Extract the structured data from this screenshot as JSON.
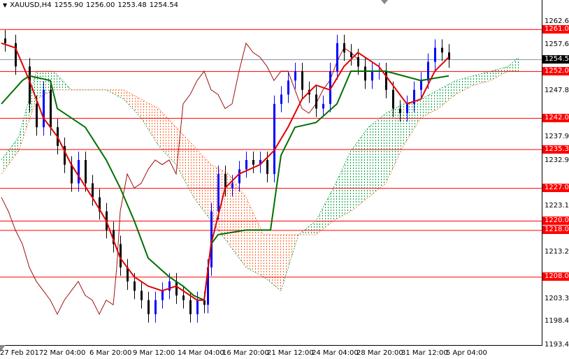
{
  "header": {
    "symbol": "XAUUSD,H4",
    "open": "1255.90",
    "high": "1256.00",
    "low": "1253.48",
    "close": "1254.54"
  },
  "colors": {
    "level": "#ff0000",
    "tenkan": "#e00000",
    "kijun": "#007000",
    "chikou": "#a01010",
    "cloud_bull": "#00a040",
    "cloud_bear": "#ff6020",
    "bull_candle": "#0000ff",
    "bear_candle": "#000000"
  },
  "y_axis": {
    "min": 1193.4,
    "max": 1262.6,
    "ticks": [
      "1262.60",
      "1257.60",
      "1247.80",
      "1237.90",
      "1232.90",
      "1223.10",
      "1213.20",
      "1203.30",
      "1198.40",
      "1193.40"
    ]
  },
  "levels": [
    "1261.00",
    "1252.00",
    "1242.00",
    "1235.30",
    "1227.00",
    "1220.00",
    "1218.00",
    "1208.00"
  ],
  "current_price": "1254.54",
  "x_axis": {
    "labels": [
      "27 Feb 2017",
      "2 Mar 04:00",
      "6 Mar 20:00",
      "9 Mar 12:00",
      "14 Mar 04:00",
      "16 Mar 20:00",
      "21 Mar 12:00",
      "24 Mar 04:00",
      "28 Mar 20:00",
      "31 Mar 12:00",
      "5 Apr 04:00"
    ]
  },
  "chart_data": {
    "type": "line",
    "title": "XAUUSD,H4",
    "x_unit": "bar index (H4)",
    "closes": [
      [
        1,
        1258
      ],
      [
        4,
        1253
      ],
      [
        8,
        1245
      ],
      [
        10,
        1240
      ],
      [
        12,
        1248
      ],
      [
        14,
        1240
      ],
      [
        16,
        1236
      ],
      [
        18,
        1232
      ],
      [
        20,
        1228
      ],
      [
        22,
        1233
      ],
      [
        24,
        1228
      ],
      [
        26,
        1225
      ],
      [
        28,
        1222
      ],
      [
        30,
        1218
      ],
      [
        32,
        1215
      ],
      [
        34,
        1210
      ],
      [
        36,
        1207
      ],
      [
        38,
        1205
      ],
      [
        40,
        1203
      ],
      [
        42,
        1200
      ],
      [
        44,
        1203
      ],
      [
        46,
        1205
      ],
      [
        48,
        1207
      ],
      [
        50,
        1204
      ],
      [
        52,
        1203
      ],
      [
        54,
        1200
      ],
      [
        56,
        1203
      ],
      [
        58,
        1202
      ],
      [
        59,
        1210
      ],
      [
        60,
        1222
      ],
      [
        62,
        1230
      ],
      [
        64,
        1227
      ],
      [
        66,
        1228
      ],
      [
        68,
        1231
      ],
      [
        70,
        1233
      ],
      [
        72,
        1232
      ],
      [
        74,
        1233
      ],
      [
        76,
        1230
      ],
      [
        78,
        1245
      ],
      [
        80,
        1247
      ],
      [
        82,
        1250
      ],
      [
        84,
        1252
      ],
      [
        86,
        1248
      ],
      [
        88,
        1247
      ],
      [
        90,
        1244
      ],
      [
        92,
        1245
      ],
      [
        94,
        1252
      ],
      [
        96,
        1258
      ],
      [
        98,
        1256
      ],
      [
        100,
        1255
      ],
      [
        102,
        1253
      ],
      [
        104,
        1250
      ],
      [
        106,
        1252
      ],
      [
        108,
        1252
      ],
      [
        110,
        1248
      ],
      [
        112,
        1244
      ],
      [
        114,
        1243
      ],
      [
        116,
        1245
      ],
      [
        118,
        1248
      ],
      [
        120,
        1250
      ],
      [
        122,
        1254
      ],
      [
        124,
        1257
      ],
      [
        126,
        1256
      ],
      [
        128,
        1254.54
      ]
    ],
    "tenkan": [
      [
        0,
        1258
      ],
      [
        4,
        1257
      ],
      [
        8,
        1250
      ],
      [
        12,
        1242
      ],
      [
        16,
        1238
      ],
      [
        20,
        1232
      ],
      [
        26,
        1225
      ],
      [
        30,
        1220
      ],
      [
        34,
        1212
      ],
      [
        38,
        1208
      ],
      [
        42,
        1206
      ],
      [
        46,
        1205
      ],
      [
        50,
        1206
      ],
      [
        56,
        1203
      ],
      [
        58,
        1203
      ],
      [
        60,
        1215
      ],
      [
        64,
        1227
      ],
      [
        68,
        1230
      ],
      [
        74,
        1232
      ],
      [
        78,
        1235
      ],
      [
        82,
        1240
      ],
      [
        86,
        1246
      ],
      [
        90,
        1249
      ],
      [
        94,
        1248
      ],
      [
        98,
        1253
      ],
      [
        102,
        1256
      ],
      [
        108,
        1253
      ],
      [
        112,
        1249
      ],
      [
        116,
        1245
      ],
      [
        120,
        1246
      ],
      [
        124,
        1252
      ],
      [
        128,
        1255
      ]
    ],
    "kijun": [
      [
        0,
        1245
      ],
      [
        6,
        1250
      ],
      [
        8,
        1251
      ],
      [
        14,
        1250
      ],
      [
        16,
        1244
      ],
      [
        24,
        1240
      ],
      [
        30,
        1233
      ],
      [
        34,
        1227
      ],
      [
        38,
        1220
      ],
      [
        42,
        1212
      ],
      [
        48,
        1208
      ],
      [
        52,
        1206
      ],
      [
        55,
        1204
      ],
      [
        58,
        1203
      ],
      [
        60,
        1215
      ],
      [
        62,
        1217
      ],
      [
        70,
        1218
      ],
      [
        77,
        1218
      ],
      [
        80,
        1234
      ],
      [
        84,
        1240
      ],
      [
        90,
        1241
      ],
      [
        96,
        1245
      ],
      [
        100,
        1252
      ],
      [
        110,
        1252
      ],
      [
        115,
        1251
      ],
      [
        120,
        1250
      ],
      [
        128,
        1251
      ]
    ],
    "cloud": [
      [
        0,
        1233,
        1230
      ],
      [
        5,
        1238,
        1235
      ],
      [
        10,
        1252,
        1246
      ],
      [
        15,
        1252,
        1248
      ],
      [
        20,
        1248,
        1248
      ],
      [
        30,
        1248,
        1248
      ],
      [
        35,
        1246,
        1248
      ],
      [
        40,
        1242,
        1246
      ],
      [
        45,
        1236,
        1244
      ],
      [
        50,
        1232,
        1240
      ],
      [
        55,
        1225,
        1236
      ],
      [
        60,
        1220,
        1232
      ],
      [
        65,
        1215,
        1230
      ],
      [
        70,
        1210,
        1225
      ],
      [
        75,
        1208,
        1217
      ],
      [
        80,
        1205,
        1217
      ],
      [
        85,
        1217,
        1217
      ],
      [
        90,
        1220,
        1217
      ],
      [
        95,
        1227,
        1220
      ],
      [
        100,
        1235,
        1222
      ],
      [
        105,
        1240,
        1225
      ],
      [
        110,
        1243,
        1228
      ],
      [
        115,
        1245,
        1236
      ],
      [
        120,
        1246,
        1242
      ],
      [
        125,
        1248,
        1244
      ],
      [
        130,
        1250,
        1247
      ],
      [
        135,
        1251,
        1249
      ],
      [
        140,
        1252,
        1250
      ],
      [
        145,
        1253,
        1252
      ],
      [
        148,
        1255,
        1252
      ]
    ],
    "chikou_shift": 26
  }
}
